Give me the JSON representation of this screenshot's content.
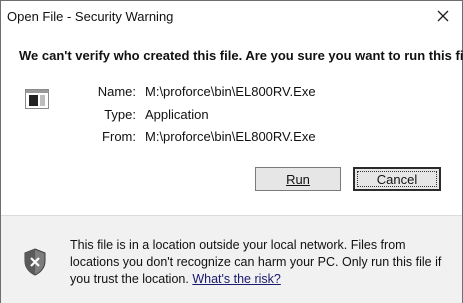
{
  "window": {
    "title": "Open File - Security Warning"
  },
  "headline": "We can't verify who created this file. Are you sure you want to run this file?",
  "details": {
    "name_label": "Name:",
    "name_value": "M:\\proforce\\bin\\EL800RV.Exe",
    "type_label": "Type:",
    "type_value": "Application",
    "from_label": "From:",
    "from_value": "M:\\proforce\\bin\\EL800RV.Exe"
  },
  "buttons": {
    "run_label": "Run",
    "cancel_label": "Cancel"
  },
  "footer": {
    "message": "This file is in a location outside your local network. Files from locations you don't recognize can harm your PC. Only run this file if you trust the location.",
    "link_text": "What's the risk?"
  },
  "icons": {
    "close": "close-icon",
    "file": "application-file-icon",
    "shield": "security-shield-warning-icon"
  }
}
